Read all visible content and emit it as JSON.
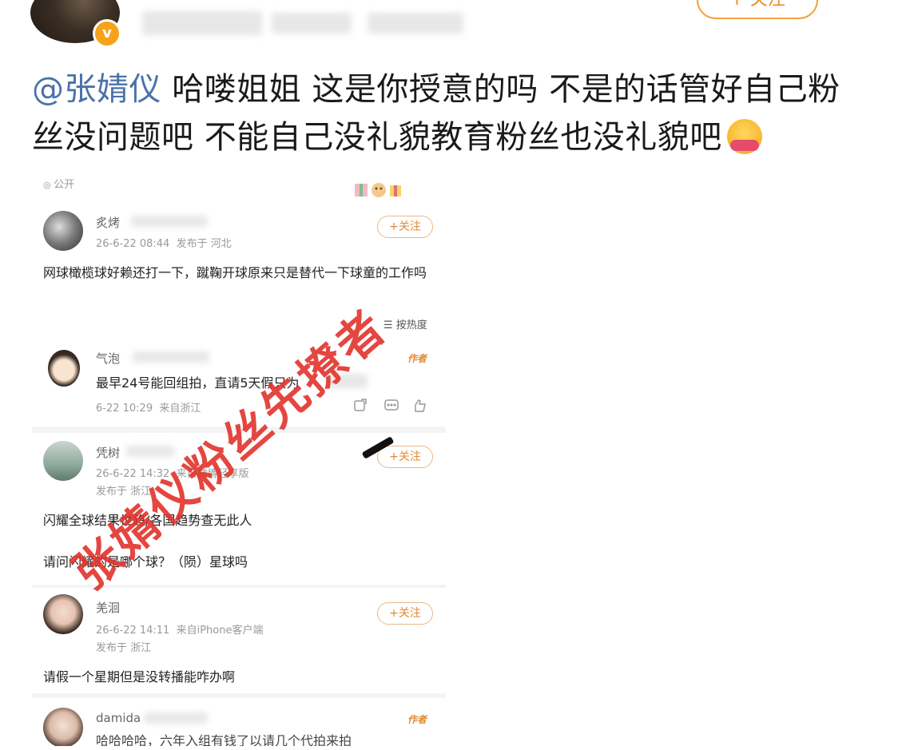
{
  "header": {
    "follow_label": "+ 关注"
  },
  "post": {
    "mention": "@张婧仪",
    "text": " 哈喽姐姐 这是你授意的吗 不是的话管好自己粉丝没问题吧 不能自己没礼貌教育粉丝也没礼貌吧",
    "emoji": "hugging-face-emoji"
  },
  "screenshot": {
    "top_fragment": "公开",
    "follow_label": "+关注",
    "sort_label": "按热度",
    "author_tag": "作者",
    "comments": [
      {
        "name": "炙烤",
        "time": "26-6-22 08:44",
        "location": "发布于 河北",
        "text": "网球橄榄球好赖还打一下，蹴鞠开球原来只是替代一下球童的工作吗"
      },
      {
        "name": "气泡",
        "reply_text": "最早24号能回组拍，直请5天假只为",
        "time": "6-22 10:29",
        "location": "来自浙江"
      },
      {
        "name": "凭树",
        "time": "26-6-22 14:32",
        "source": "来自微博轻享版",
        "location": "发布于 浙江",
        "text_line1": "闪耀全球结果世趋/各国趋势查无此人",
        "text_line2": "请问闪耀的是哪个球？（陨）星球吗"
      },
      {
        "name": "羌洄",
        "time": "26-6-22 14:11",
        "source": "来自iPhone客户端",
        "location": "发布于 浙江",
        "text": "请假一个星期但是没转播能咋办啊"
      },
      {
        "name": "damida",
        "text": "哈哈哈哈，六年入组有钱了以请几个代拍来拍"
      }
    ]
  },
  "watermark": {
    "text": "张婧仪粉丝先撩者"
  },
  "colors": {
    "mention": "#4a72a8",
    "follow_orange": "#f08a1d",
    "watermark_red": "#e2322c"
  }
}
